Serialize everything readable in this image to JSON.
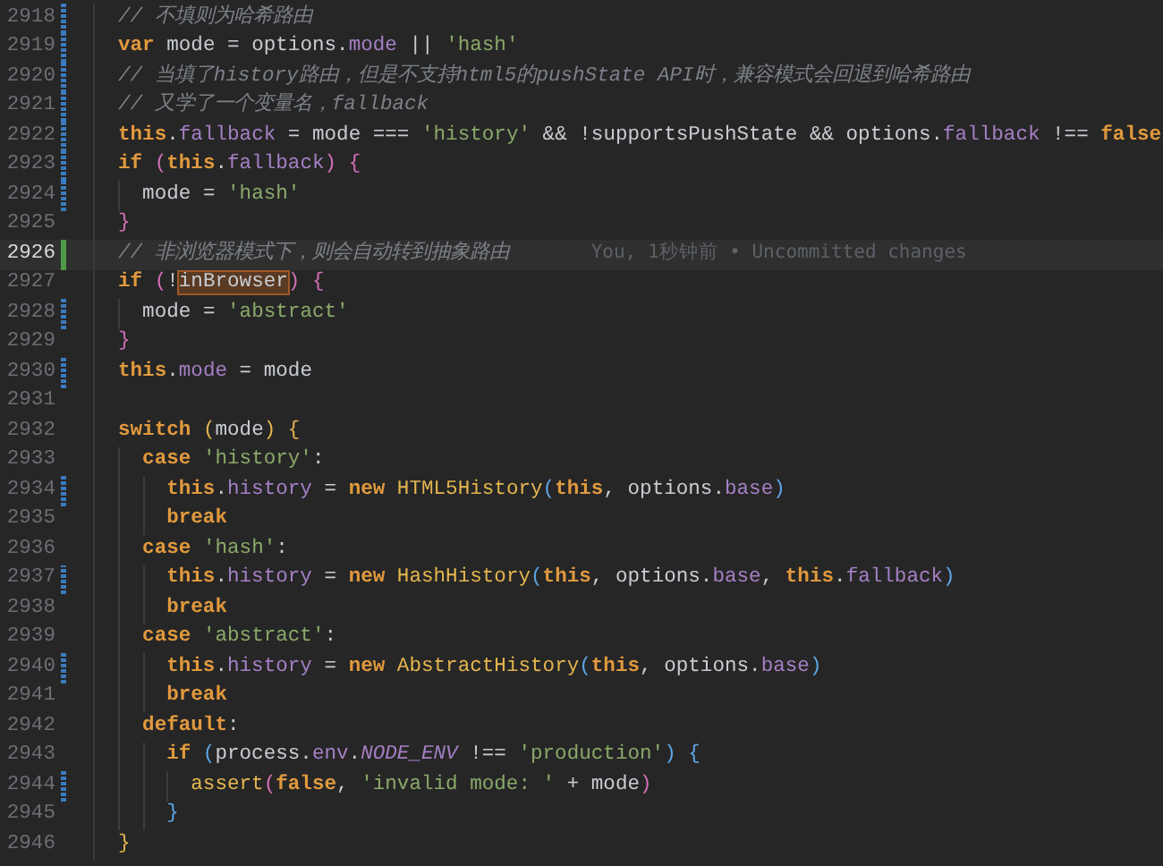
{
  "editor": {
    "lines": [
      {
        "number": "2918",
        "current": false,
        "modified": true,
        "added": false,
        "tokens": [
          {
            "kind": "comment",
            "text": "// 不填则为哈希路由"
          }
        ]
      },
      {
        "number": "2919",
        "current": false,
        "modified": true,
        "added": false,
        "tokens": [
          {
            "kind": "keyword",
            "text": "var"
          },
          {
            "kind": "plain",
            "text": " mode = options."
          },
          {
            "kind": "property",
            "text": "mode"
          },
          {
            "kind": "plain",
            "text": " || "
          },
          {
            "kind": "string",
            "text": "'hash'"
          }
        ]
      },
      {
        "number": "2920",
        "current": false,
        "modified": true,
        "added": false,
        "tokens": [
          {
            "kind": "comment",
            "text": "// 当填了history路由，但是不支持html5的pushState API时，兼容模式会回退到哈希路由"
          }
        ]
      },
      {
        "number": "2921",
        "current": false,
        "modified": true,
        "added": false,
        "tokens": [
          {
            "kind": "comment",
            "text": "// 又学了一个变量名，fallback"
          }
        ]
      },
      {
        "number": "2922",
        "current": false,
        "modified": true,
        "added": false,
        "tokens": [
          {
            "kind": "keyword",
            "text": "this"
          },
          {
            "kind": "plain",
            "text": "."
          },
          {
            "kind": "property",
            "text": "fallback"
          },
          {
            "kind": "plain",
            "text": " = mode === "
          },
          {
            "kind": "string",
            "text": "'history'"
          },
          {
            "kind": "plain",
            "text": " && !supportsPushState && options."
          },
          {
            "kind": "property",
            "text": "fallback"
          },
          {
            "kind": "plain",
            "text": " !== "
          },
          {
            "kind": "keyword",
            "text": "false"
          }
        ]
      },
      {
        "number": "2923",
        "current": false,
        "modified": true,
        "added": false,
        "tokens": [
          {
            "kind": "keyword",
            "text": "if"
          },
          {
            "kind": "bracket2",
            "text": " ("
          },
          {
            "kind": "keyword",
            "text": "this"
          },
          {
            "kind": "plain",
            "text": "."
          },
          {
            "kind": "property",
            "text": "fallback"
          },
          {
            "kind": "bracket2",
            "text": ") {"
          }
        ],
        "children": [
          {
            "number": "2924",
            "current": false,
            "modified": true,
            "added": false,
            "tokens": [
              {
                "kind": "plain",
                "text": "mode = "
              },
              {
                "kind": "string",
                "text": "'hash'"
              }
            ]
          }
        ]
      },
      {
        "number": "2925",
        "current": false,
        "modified": false,
        "added": false,
        "tokens": [
          {
            "kind": "bracket2",
            "text": "}"
          }
        ]
      },
      {
        "number": "2926",
        "current": true,
        "modified": false,
        "added": true,
        "tokens": [
          {
            "kind": "comment",
            "text": "// 非浏览器模式下，则会自动转到抽象路由"
          }
        ],
        "blame": "You, 1秒钟前 • Uncommitted changes"
      },
      {
        "number": "2927",
        "current": false,
        "modified": false,
        "added": false,
        "tokens": [
          {
            "kind": "keyword",
            "text": "if"
          },
          {
            "kind": "bracket2",
            "text": " ("
          },
          {
            "kind": "plain",
            "text": "!"
          },
          {
            "kind": "match",
            "text": "inBrowser"
          },
          {
            "kind": "bracket2",
            "text": ") {"
          }
        ],
        "children": [
          {
            "number": "2928",
            "current": false,
            "modified": true,
            "added": false,
            "tokens": [
              {
                "kind": "plain",
                "text": "mode = "
              },
              {
                "kind": "string",
                "text": "'abstract'"
              }
            ]
          }
        ]
      },
      {
        "number": "2929",
        "current": false,
        "modified": false,
        "added": false,
        "tokens": [
          {
            "kind": "bracket2",
            "text": "}"
          }
        ]
      },
      {
        "number": "2930",
        "current": false,
        "modified": true,
        "added": false,
        "tokens": [
          {
            "kind": "keyword",
            "text": "this"
          },
          {
            "kind": "plain",
            "text": "."
          },
          {
            "kind": "property",
            "text": "mode"
          },
          {
            "kind": "plain",
            "text": " = mode"
          }
        ]
      },
      {
        "number": "2931",
        "current": false,
        "modified": false,
        "added": false
      },
      {
        "number": "2932",
        "current": false,
        "modified": false,
        "added": false,
        "tokens": [
          {
            "kind": "keyword",
            "text": "switch"
          },
          {
            "kind": "bracket1",
            "text": " ("
          },
          {
            "kind": "plain",
            "text": "mode"
          },
          {
            "kind": "bracket1",
            "text": ") {"
          }
        ],
        "children": [
          {
            "number": "2933",
            "current": false,
            "modified": false,
            "added": false,
            "tokens": [
              {
                "kind": "keyword",
                "text": "case"
              },
              {
                "kind": "string",
                "text": " 'history'"
              },
              {
                "kind": "plain",
                "text": ":"
              }
            ],
            "children": [
              {
                "number": "2934",
                "current": false,
                "modified": true,
                "added": false,
                "tokens": [
                  {
                    "kind": "keyword",
                    "text": "this"
                  },
                  {
                    "kind": "plain",
                    "text": "."
                  },
                  {
                    "kind": "property",
                    "text": "history"
                  },
                  {
                    "kind": "plain",
                    "text": " = "
                  },
                  {
                    "kind": "keyword",
                    "text": "new"
                  },
                  {
                    "kind": "class",
                    "text": " HTML5History"
                  },
                  {
                    "kind": "bracket3",
                    "text": "("
                  },
                  {
                    "kind": "keyword",
                    "text": "this"
                  },
                  {
                    "kind": "plain",
                    "text": ", options."
                  },
                  {
                    "kind": "property",
                    "text": "base"
                  },
                  {
                    "kind": "bracket3",
                    "text": ")"
                  }
                ]
              },
              {
                "number": "2935",
                "current": false,
                "modified": false,
                "added": false,
                "tokens": [
                  {
                    "kind": "keyword",
                    "text": "break"
                  }
                ]
              }
            ]
          },
          {
            "number": "2936",
            "current": false,
            "modified": false,
            "added": false,
            "tokens": [
              {
                "kind": "keyword",
                "text": "case"
              },
              {
                "kind": "string",
                "text": " 'hash'"
              },
              {
                "kind": "plain",
                "text": ":"
              }
            ],
            "children": [
              {
                "number": "2937",
                "current": false,
                "modified": true,
                "added": false,
                "tokens": [
                  {
                    "kind": "keyword",
                    "text": "this"
                  },
                  {
                    "kind": "plain",
                    "text": "."
                  },
                  {
                    "kind": "property",
                    "text": "history"
                  },
                  {
                    "kind": "plain",
                    "text": " = "
                  },
                  {
                    "kind": "keyword",
                    "text": "new"
                  },
                  {
                    "kind": "class",
                    "text": " HashHistory"
                  },
                  {
                    "kind": "bracket3",
                    "text": "("
                  },
                  {
                    "kind": "keyword",
                    "text": "this"
                  },
                  {
                    "kind": "plain",
                    "text": ", options."
                  },
                  {
                    "kind": "property",
                    "text": "base"
                  },
                  {
                    "kind": "plain",
                    "text": ", "
                  },
                  {
                    "kind": "keyword",
                    "text": "this"
                  },
                  {
                    "kind": "plain",
                    "text": "."
                  },
                  {
                    "kind": "property",
                    "text": "fallback"
                  },
                  {
                    "kind": "bracket3",
                    "text": ")"
                  }
                ]
              },
              {
                "number": "2938",
                "current": false,
                "modified": false,
                "added": false,
                "tokens": [
                  {
                    "kind": "keyword",
                    "text": "break"
                  }
                ]
              }
            ]
          },
          {
            "number": "2939",
            "current": false,
            "modified": false,
            "added": false,
            "tokens": [
              {
                "kind": "keyword",
                "text": "case"
              },
              {
                "kind": "string",
                "text": " 'abstract'"
              },
              {
                "kind": "plain",
                "text": ":"
              }
            ],
            "children": [
              {
                "number": "2940",
                "current": false,
                "modified": true,
                "added": false,
                "tokens": [
                  {
                    "kind": "keyword",
                    "text": "this"
                  },
                  {
                    "kind": "plain",
                    "text": "."
                  },
                  {
                    "kind": "property",
                    "text": "history"
                  },
                  {
                    "kind": "plain",
                    "text": " = "
                  },
                  {
                    "kind": "keyword",
                    "text": "new"
                  },
                  {
                    "kind": "class",
                    "text": " AbstractHistory"
                  },
                  {
                    "kind": "bracket3",
                    "text": "("
                  },
                  {
                    "kind": "keyword",
                    "text": "this"
                  },
                  {
                    "kind": "plain",
                    "text": ", options."
                  },
                  {
                    "kind": "property",
                    "text": "base"
                  },
                  {
                    "kind": "bracket3",
                    "text": ")"
                  }
                ]
              },
              {
                "number": "2941",
                "current": false,
                "modified": false,
                "added": false,
                "tokens": [
                  {
                    "kind": "keyword",
                    "text": "break"
                  }
                ]
              }
            ]
          },
          {
            "number": "2942",
            "current": false,
            "modified": false,
            "added": false,
            "tokens": [
              {
                "kind": "keyword",
                "text": "default"
              },
              {
                "kind": "plain",
                "text": ":"
              }
            ],
            "children": [
              {
                "number": "2943",
                "current": false,
                "modified": false,
                "added": false,
                "tokens": [
                  {
                    "kind": "keyword",
                    "text": "if"
                  },
                  {
                    "kind": "bracket3",
                    "text": " ("
                  },
                  {
                    "kind": "plain",
                    "text": "process."
                  },
                  {
                    "kind": "property",
                    "text": "env"
                  },
                  {
                    "kind": "plain",
                    "text": "."
                  },
                  {
                    "kind": "constant",
                    "text": "NODE_ENV"
                  },
                  {
                    "kind": "plain",
                    "text": " !== "
                  },
                  {
                    "kind": "string",
                    "text": "'production'"
                  },
                  {
                    "kind": "bracket3",
                    "text": ") {"
                  }
                ],
                "children": [
                  {
                    "number": "2944",
                    "current": false,
                    "modified": true,
                    "added": false,
                    "tokens": [
                      {
                        "kind": "class",
                        "text": "assert"
                      },
                      {
                        "kind": "bracket2",
                        "text": "("
                      },
                      {
                        "kind": "keyword",
                        "text": "false"
                      },
                      {
                        "kind": "plain",
                        "text": ", "
                      },
                      {
                        "kind": "string",
                        "text": "'invalid mode: '"
                      },
                      {
                        "kind": "plain",
                        "text": " + mode"
                      },
                      {
                        "kind": "bracket2",
                        "text": ")"
                      }
                    ]
                  }
                ]
              },
              {
                "number": "2945",
                "current": false,
                "modified": false,
                "added": false,
                "tokens": [
                  {
                    "kind": "bracket3",
                    "text": "}"
                  }
                ]
              }
            ]
          }
        ]
      },
      {
        "number": "2946",
        "current": false,
        "modified": false,
        "added": false,
        "tokens": [
          {
            "kind": "bracket1",
            "text": "}"
          }
        ]
      }
    ]
  }
}
